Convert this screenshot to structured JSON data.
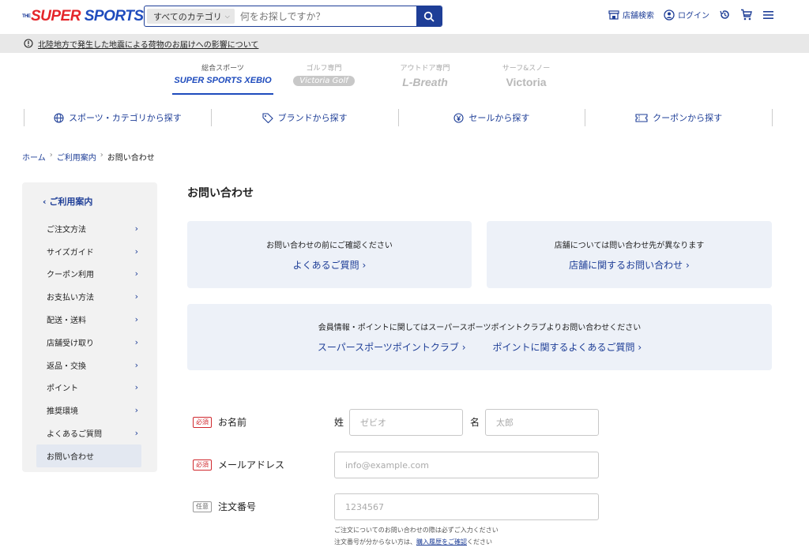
{
  "header": {
    "logo_the": "THE",
    "logo_super": "SUPER",
    "logo_sports": "SPORTS",
    "search_category": "すべてのカテゴリ",
    "search_placeholder": "何をお探しですか？",
    "store_search": "店舗検索",
    "login": "ログイン"
  },
  "notice": {
    "text": "北陸地方で発生した地震による荷物のお届けへの影響について"
  },
  "brands": [
    {
      "sub": "総合スポーツ",
      "name": "SUPER SPORTS XEBIO"
    },
    {
      "sub": "ゴルフ専門",
      "name": "Victoria Golf"
    },
    {
      "sub": "アウトドア専門",
      "name": "L-Breath"
    },
    {
      "sub": "サーフ&スノー",
      "name": "Victoria"
    }
  ],
  "catnav": [
    {
      "label": "スポーツ・カテゴリから探す",
      "icon": "globe-icon"
    },
    {
      "label": "ブランドから探す",
      "icon": "tag-icon"
    },
    {
      "label": "セールから探す",
      "icon": "yen-icon"
    },
    {
      "label": "クーポンから探す",
      "icon": "coupon-icon"
    }
  ],
  "breadcrumb": {
    "home": "ホーム",
    "guide": "ご利用案内",
    "current": "お問い合わせ"
  },
  "sidebar": {
    "heading": "ご利用案内",
    "items": [
      {
        "label": "ご注文方法"
      },
      {
        "label": "サイズガイド"
      },
      {
        "label": "クーポン利用"
      },
      {
        "label": "お支払い方法"
      },
      {
        "label": "配送・送料"
      },
      {
        "label": "店舗受け取り"
      },
      {
        "label": "返品・交換"
      },
      {
        "label": "ポイント"
      },
      {
        "label": "推奨環境"
      },
      {
        "label": "よくあるご質問"
      },
      {
        "label": "お問い合わせ"
      }
    ]
  },
  "main": {
    "title": "お問い合わせ",
    "box1": {
      "lead": "お問い合わせの前にご確認ください",
      "link": "よくあるご質問"
    },
    "box2": {
      "lead": "店舗については問い合わせ先が異なります",
      "link": "店舗に関するお問い合わせ"
    },
    "box3": {
      "lead": "会員情報・ポイントに関してはスーパースポーツポイントクラブよりお問い合わせください",
      "link1": "スーパースポーツポイントクラブ",
      "link2": "ポイントに関するよくあるご質問"
    }
  },
  "form": {
    "required_tag": "必須",
    "optional_tag": "任意",
    "name_label": "お名前",
    "last_label": "姓",
    "first_label": "名",
    "last_placeholder": "ゼビオ",
    "first_placeholder": "太郎",
    "email_label": "メールアドレス",
    "email_placeholder": "info@example.com",
    "order_label": "注文番号",
    "order_placeholder": "1234567",
    "help1": "ご注文についてのお問い合わせの際は必ずご入力ください",
    "help2_pre": "注文番号が分からない方は、",
    "help2_link": "購入履歴をご確認",
    "help2_post": "ください"
  },
  "colors": {
    "brand_blue": "#1e3e97",
    "required_red": "#d0282e",
    "box_bg": "#edf1f8"
  }
}
